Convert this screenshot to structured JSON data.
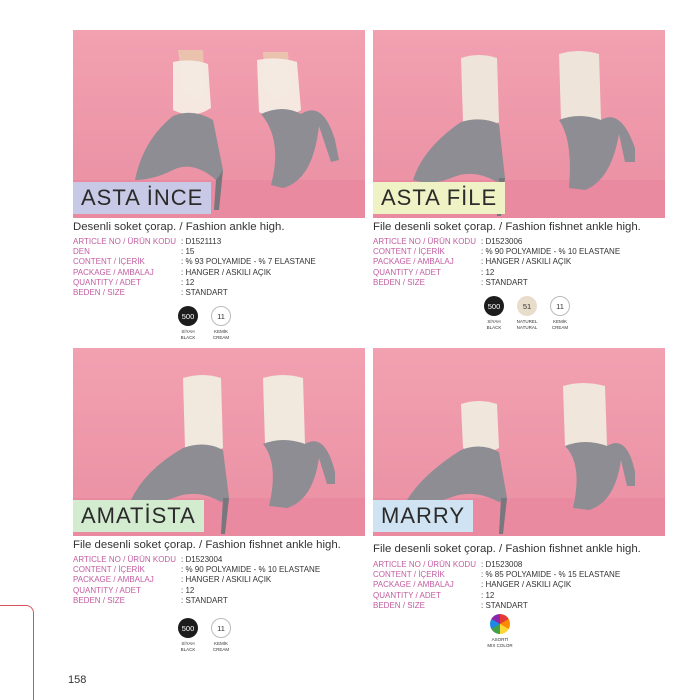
{
  "page_number": "158",
  "products": [
    {
      "name": "ASTA İNCE",
      "title_bg": "#c7c9e6",
      "subtitle": "Desenli soket çorap. / Fashion ankle high.",
      "specs": [
        {
          "label": "ARTICLE NO / ÜRÜN KODU",
          "value": ": D1521113"
        },
        {
          "label": "DEN",
          "value": ": 15"
        },
        {
          "label": "CONTENT / İÇERİK",
          "value": ": % 93 POLYAMIDE - % 7 ELASTANE"
        },
        {
          "label": "PACKAGE / AMBALAJ",
          "value": ": HANGER / ASKILI AÇIK"
        },
        {
          "label": "QUANTITY / ADET",
          "value": ": 12"
        },
        {
          "label": "BEDEN / SIZE",
          "value": ": STANDART"
        }
      ],
      "colors": [
        {
          "code": "500",
          "name1": "SİYAH",
          "name2": "BLACK",
          "style": "black"
        },
        {
          "code": "11",
          "name1": "KEMİK",
          "name2": "CREAM",
          "style": "cream"
        }
      ]
    },
    {
      "name": "ASTA FİLE",
      "title_bg": "#eef2c4",
      "subtitle": "File desenli soket çorap. / Fashion fishnet ankle high.",
      "specs": [
        {
          "label": "ARTICLE NO / ÜRÜN KODU",
          "value": ": D1523006"
        },
        {
          "label": "CONTENT / İÇERİK",
          "value": ": % 90 POLYAMIDE - % 10 ELASTANE"
        },
        {
          "label": "PACKAGE / AMBALAJ",
          "value": ": HANGER / ASKILI AÇIK"
        },
        {
          "label": "QUANTITY / ADET",
          "value": ": 12"
        },
        {
          "label": "BEDEN / SIZE",
          "value": ": STANDART"
        }
      ],
      "colors": [
        {
          "code": "500",
          "name1": "SİYAH",
          "name2": "BLACK",
          "style": "black"
        },
        {
          "code": "51",
          "name1": "NATUREL",
          "name2": "NATURAL",
          "style": "natural"
        },
        {
          "code": "11",
          "name1": "KEMİK",
          "name2": "CREAM",
          "style": "cream"
        }
      ]
    },
    {
      "name": "AMATİSTA",
      "title_bg": "#d3ecd0",
      "subtitle": "File desenli soket çorap. / Fashion fishnet ankle high.",
      "specs": [
        {
          "label": "ARTICLE NO / ÜRÜN KODU",
          "value": ": D1523004"
        },
        {
          "label": "CONTENT / İÇERİK",
          "value": ": % 90 POLYAMIDE - % 10 ELASTANE"
        },
        {
          "label": "PACKAGE / AMBALAJ",
          "value": ": HANGER / ASKILI AÇIK"
        },
        {
          "label": "QUANTITY / ADET",
          "value": ": 12"
        },
        {
          "label": "BEDEN / SIZE",
          "value": ": STANDART"
        }
      ],
      "colors": [
        {
          "code": "500",
          "name1": "SİYAH",
          "name2": "BLACK",
          "style": "black"
        },
        {
          "code": "11",
          "name1": "KEMİK",
          "name2": "CREAM",
          "style": "cream"
        }
      ]
    },
    {
      "name": "MARRY",
      "title_bg": "#cfe3f2",
      "subtitle": "File desenli soket çorap. / Fashion fishnet ankle high.",
      "specs": [
        {
          "label": "ARTICLE NO / ÜRÜN KODU",
          "value": ": D1523008"
        },
        {
          "label": "CONTENT / İÇERİK",
          "value": ": % 85 POLYAMIDE - % 15 ELASTANE"
        },
        {
          "label": "PACKAGE / AMBALAJ",
          "value": ": HANGER / ASKILI AÇIK"
        },
        {
          "label": "QUANTITY / ADET",
          "value": ": 12"
        },
        {
          "label": "BEDEN / SIZE",
          "value": ": STANDART"
        }
      ],
      "colors": [
        {
          "code": "",
          "name1": "ASORTİ",
          "name2": "MIX COLOR",
          "style": "mix"
        }
      ]
    }
  ]
}
